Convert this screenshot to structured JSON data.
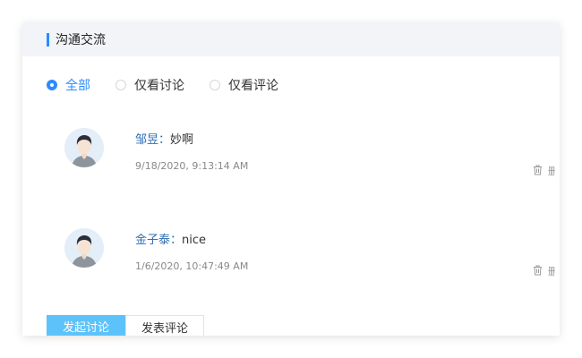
{
  "panel": {
    "title": "沟通交流"
  },
  "filters": {
    "options": [
      {
        "label": "全部",
        "checked": true
      },
      {
        "label": "仅看讨论",
        "checked": false
      },
      {
        "label": "仅看评论",
        "checked": false
      }
    ]
  },
  "comments": [
    {
      "author": "邹昱：",
      "text": "妙啊",
      "time": "9/18/2020, 9:13:14 AM",
      "delete_label": "删除"
    },
    {
      "author": "金子泰：",
      "text": "nice",
      "time": "1/6/2020, 10:47:49 AM",
      "delete_label": "删除"
    }
  ],
  "actions": {
    "start_discussion": "发起讨论",
    "post_comment": "发表评论"
  },
  "colors": {
    "accent": "#2b8cff",
    "author": "#2f6fb5",
    "primary_button": "#5ec2fa"
  },
  "icons": {
    "avatar": "user-avatar-icon",
    "delete": "trash-icon"
  }
}
